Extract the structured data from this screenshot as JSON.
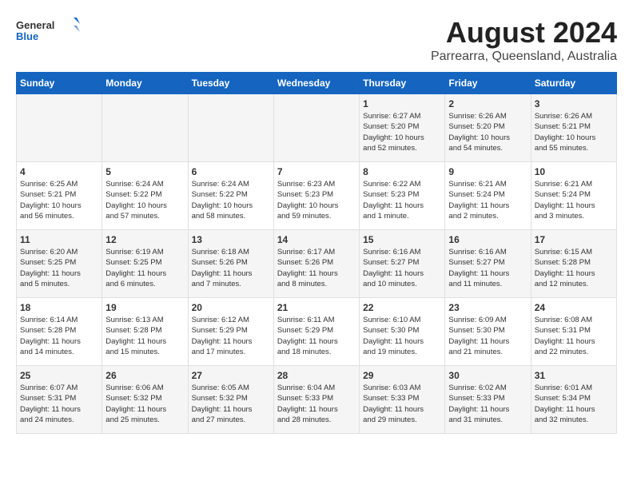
{
  "logo": {
    "general": "General",
    "blue": "Blue"
  },
  "title": "August 2024",
  "subtitle": "Parrearra, Queensland, Australia",
  "headers": [
    "Sunday",
    "Monday",
    "Tuesday",
    "Wednesday",
    "Thursday",
    "Friday",
    "Saturday"
  ],
  "weeks": [
    [
      {
        "day": "",
        "info": ""
      },
      {
        "day": "",
        "info": ""
      },
      {
        "day": "",
        "info": ""
      },
      {
        "day": "",
        "info": ""
      },
      {
        "day": "1",
        "info": "Sunrise: 6:27 AM\nSunset: 5:20 PM\nDaylight: 10 hours\nand 52 minutes."
      },
      {
        "day": "2",
        "info": "Sunrise: 6:26 AM\nSunset: 5:20 PM\nDaylight: 10 hours\nand 54 minutes."
      },
      {
        "day": "3",
        "info": "Sunrise: 6:26 AM\nSunset: 5:21 PM\nDaylight: 10 hours\nand 55 minutes."
      }
    ],
    [
      {
        "day": "4",
        "info": "Sunrise: 6:25 AM\nSunset: 5:21 PM\nDaylight: 10 hours\nand 56 minutes."
      },
      {
        "day": "5",
        "info": "Sunrise: 6:24 AM\nSunset: 5:22 PM\nDaylight: 10 hours\nand 57 minutes."
      },
      {
        "day": "6",
        "info": "Sunrise: 6:24 AM\nSunset: 5:22 PM\nDaylight: 10 hours\nand 58 minutes."
      },
      {
        "day": "7",
        "info": "Sunrise: 6:23 AM\nSunset: 5:23 PM\nDaylight: 10 hours\nand 59 minutes."
      },
      {
        "day": "8",
        "info": "Sunrise: 6:22 AM\nSunset: 5:23 PM\nDaylight: 11 hours\nand 1 minute."
      },
      {
        "day": "9",
        "info": "Sunrise: 6:21 AM\nSunset: 5:24 PM\nDaylight: 11 hours\nand 2 minutes."
      },
      {
        "day": "10",
        "info": "Sunrise: 6:21 AM\nSunset: 5:24 PM\nDaylight: 11 hours\nand 3 minutes."
      }
    ],
    [
      {
        "day": "11",
        "info": "Sunrise: 6:20 AM\nSunset: 5:25 PM\nDaylight: 11 hours\nand 5 minutes."
      },
      {
        "day": "12",
        "info": "Sunrise: 6:19 AM\nSunset: 5:25 PM\nDaylight: 11 hours\nand 6 minutes."
      },
      {
        "day": "13",
        "info": "Sunrise: 6:18 AM\nSunset: 5:26 PM\nDaylight: 11 hours\nand 7 minutes."
      },
      {
        "day": "14",
        "info": "Sunrise: 6:17 AM\nSunset: 5:26 PM\nDaylight: 11 hours\nand 8 minutes."
      },
      {
        "day": "15",
        "info": "Sunrise: 6:16 AM\nSunset: 5:27 PM\nDaylight: 11 hours\nand 10 minutes."
      },
      {
        "day": "16",
        "info": "Sunrise: 6:16 AM\nSunset: 5:27 PM\nDaylight: 11 hours\nand 11 minutes."
      },
      {
        "day": "17",
        "info": "Sunrise: 6:15 AM\nSunset: 5:28 PM\nDaylight: 11 hours\nand 12 minutes."
      }
    ],
    [
      {
        "day": "18",
        "info": "Sunrise: 6:14 AM\nSunset: 5:28 PM\nDaylight: 11 hours\nand 14 minutes."
      },
      {
        "day": "19",
        "info": "Sunrise: 6:13 AM\nSunset: 5:28 PM\nDaylight: 11 hours\nand 15 minutes."
      },
      {
        "day": "20",
        "info": "Sunrise: 6:12 AM\nSunset: 5:29 PM\nDaylight: 11 hours\nand 17 minutes."
      },
      {
        "day": "21",
        "info": "Sunrise: 6:11 AM\nSunset: 5:29 PM\nDaylight: 11 hours\nand 18 minutes."
      },
      {
        "day": "22",
        "info": "Sunrise: 6:10 AM\nSunset: 5:30 PM\nDaylight: 11 hours\nand 19 minutes."
      },
      {
        "day": "23",
        "info": "Sunrise: 6:09 AM\nSunset: 5:30 PM\nDaylight: 11 hours\nand 21 minutes."
      },
      {
        "day": "24",
        "info": "Sunrise: 6:08 AM\nSunset: 5:31 PM\nDaylight: 11 hours\nand 22 minutes."
      }
    ],
    [
      {
        "day": "25",
        "info": "Sunrise: 6:07 AM\nSunset: 5:31 PM\nDaylight: 11 hours\nand 24 minutes."
      },
      {
        "day": "26",
        "info": "Sunrise: 6:06 AM\nSunset: 5:32 PM\nDaylight: 11 hours\nand 25 minutes."
      },
      {
        "day": "27",
        "info": "Sunrise: 6:05 AM\nSunset: 5:32 PM\nDaylight: 11 hours\nand 27 minutes."
      },
      {
        "day": "28",
        "info": "Sunrise: 6:04 AM\nSunset: 5:33 PM\nDaylight: 11 hours\nand 28 minutes."
      },
      {
        "day": "29",
        "info": "Sunrise: 6:03 AM\nSunset: 5:33 PM\nDaylight: 11 hours\nand 29 minutes."
      },
      {
        "day": "30",
        "info": "Sunrise: 6:02 AM\nSunset: 5:33 PM\nDaylight: 11 hours\nand 31 minutes."
      },
      {
        "day": "31",
        "info": "Sunrise: 6:01 AM\nSunset: 5:34 PM\nDaylight: 11 hours\nand 32 minutes."
      }
    ]
  ]
}
